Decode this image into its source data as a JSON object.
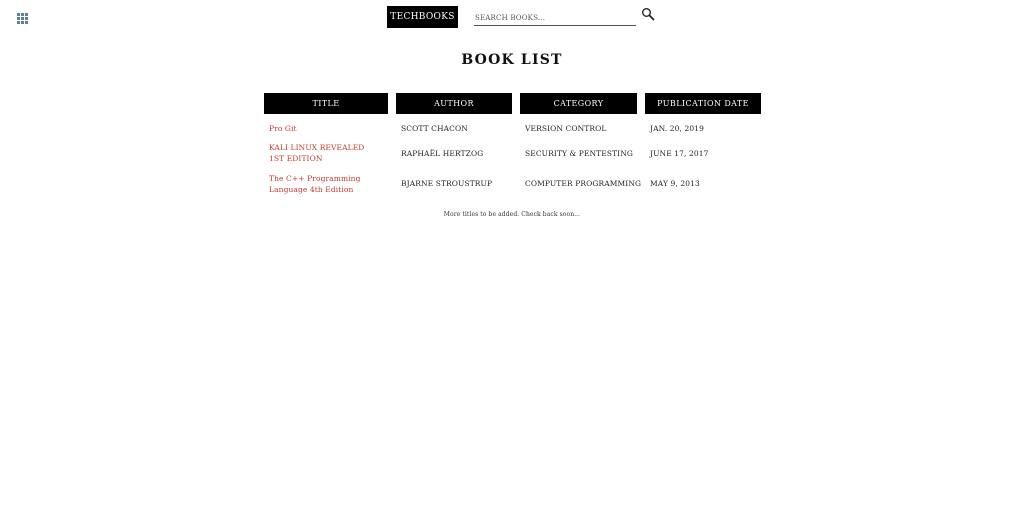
{
  "header": {
    "menu_icon": "grid-icon",
    "brand": "TECHBOOKS",
    "search_placeholder": "SEARCH BOOKS...",
    "search_icon": "magnifier-icon"
  },
  "main": {
    "title": "BOOK LIST",
    "columns": [
      "TITLE",
      "AUTHOR",
      "CATEGORY",
      "PUBLICATION DATE"
    ],
    "rows": [
      {
        "title": "Pro Git",
        "author": "SCOTT CHACON",
        "category": "VERSION CONTROL",
        "date": "JAN. 20, 2019"
      },
      {
        "title": "KALI LINUX REVEALED 1ST EDITION",
        "author": "RAPHAËL HERTZOG",
        "category": "SECURITY & PENTESTING",
        "date": "JUNE 17, 2017"
      },
      {
        "title": "The C++ Programming Language 4th Edition",
        "author": "BJARNE STROUSTRUP",
        "category": "COMPUTER PROGRAMMING",
        "date": "MAY 9, 2013"
      }
    ],
    "footer_note": "More titles to be added. Check back soon..."
  },
  "colors": {
    "link": "#c0392b",
    "header_bg": "#000000",
    "menu_icon": "#5b7f95"
  }
}
